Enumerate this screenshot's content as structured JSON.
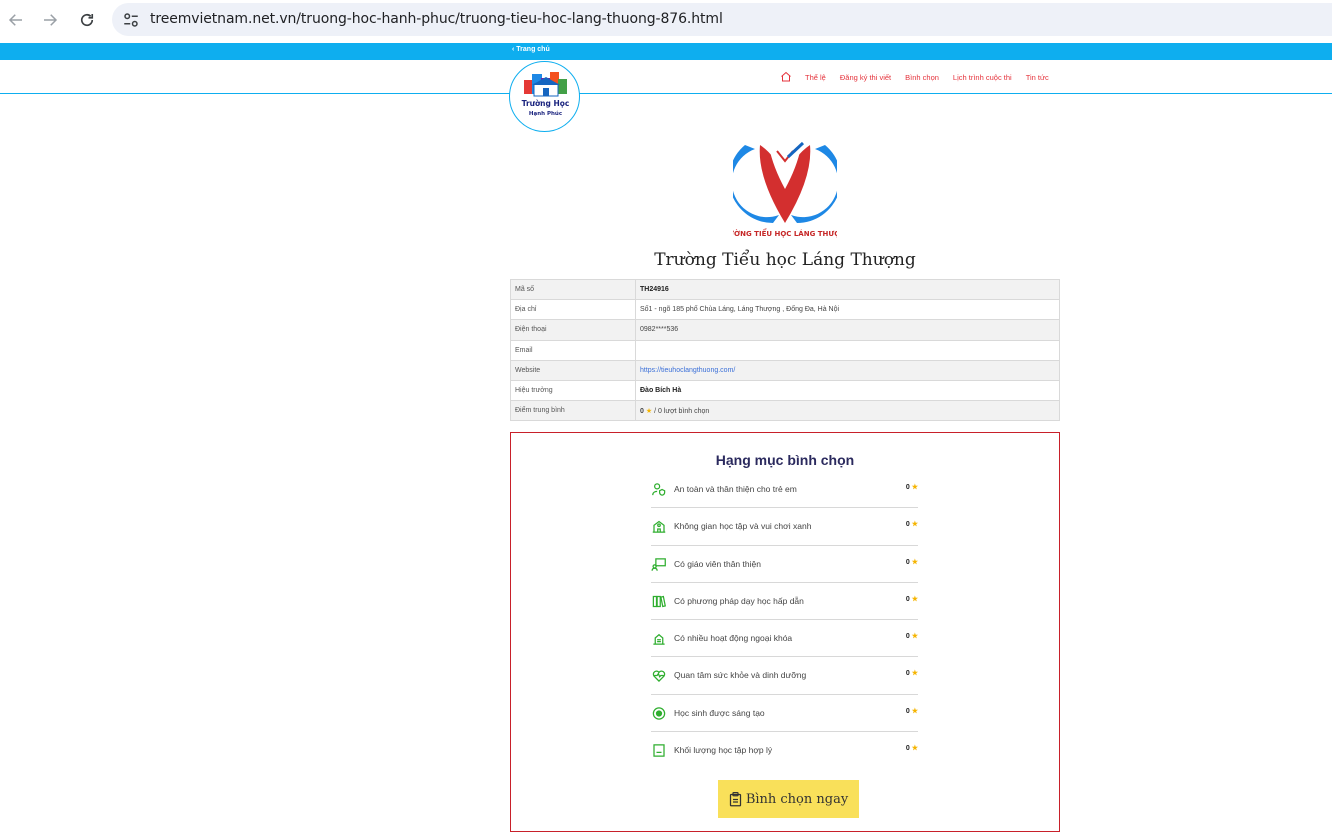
{
  "browser": {
    "url": "treemvietnam.net.vn/truong-hoc-hanh-phuc/truong-tieu-hoc-lang-thuong-876.html"
  },
  "topbar": {
    "home_link": "Trang chủ"
  },
  "logo": {
    "line1": "Trường Học",
    "line2": "Hạnh Phúc"
  },
  "menu": {
    "items": [
      "Thể lệ",
      "Đăng ký thi viết",
      "Bình chọn",
      "Lịch trình cuộc thi",
      "Tin tức"
    ]
  },
  "school": {
    "emblem_text": "TRƯỜNG TIỂU HỌC LÁNG THƯỢNG",
    "name": "Trường Tiểu học Láng Thượng",
    "info": [
      {
        "label": "Mã số",
        "value": "TH24916"
      },
      {
        "label": "Địa chỉ",
        "value": "Số1 - ngõ 185 phố Chùa Láng, Láng Thượng , Đống Đa, Hà Nội"
      },
      {
        "label": "Điện thoại",
        "value": "0982****536"
      },
      {
        "label": "Email",
        "value": ""
      },
      {
        "label": "Website",
        "value": "https://tieuhoclangthuong.com/"
      },
      {
        "label": "Hiệu trưởng",
        "value": "Đào Bích Hà"
      },
      {
        "label": "Điểm trung bình",
        "score": "0",
        "votes": "/ 0 lượt bình chọn"
      }
    ]
  },
  "voting": {
    "title": "Hạng mục bình chọn",
    "criteria": [
      {
        "label": "An toàn và thân thiện cho trẻ em",
        "score": "0",
        "icon": "user-shield-icon"
      },
      {
        "label": "Không gian học tập và vui chơi xanh",
        "score": "0",
        "icon": "school-building-icon"
      },
      {
        "label": "Có giáo viên thân thiện",
        "score": "0",
        "icon": "teacher-board-icon"
      },
      {
        "label": "Có phương pháp dạy học hấp dẫn",
        "score": "0",
        "icon": "books-icon"
      },
      {
        "label": "Có nhiều hoạt động ngoại khóa",
        "score": "0",
        "icon": "activity-icon"
      },
      {
        "label": "Quan tâm sức khỏe và dinh dưỡng",
        "score": "0",
        "icon": "heart-pulse-icon"
      },
      {
        "label": "Học sinh được sáng tạo",
        "score": "0",
        "icon": "target-icon"
      },
      {
        "label": "Khối lượng học tập hợp lý",
        "score": "0",
        "icon": "tablet-icon"
      }
    ],
    "vote_button": "Bình chọn ngay"
  },
  "colors": {
    "accent_blue": "#0eaeef",
    "accent_red": "#e5323b",
    "icon_green": "#2fae2f",
    "star": "#f5b400",
    "button_yellow": "#f9e05a"
  }
}
